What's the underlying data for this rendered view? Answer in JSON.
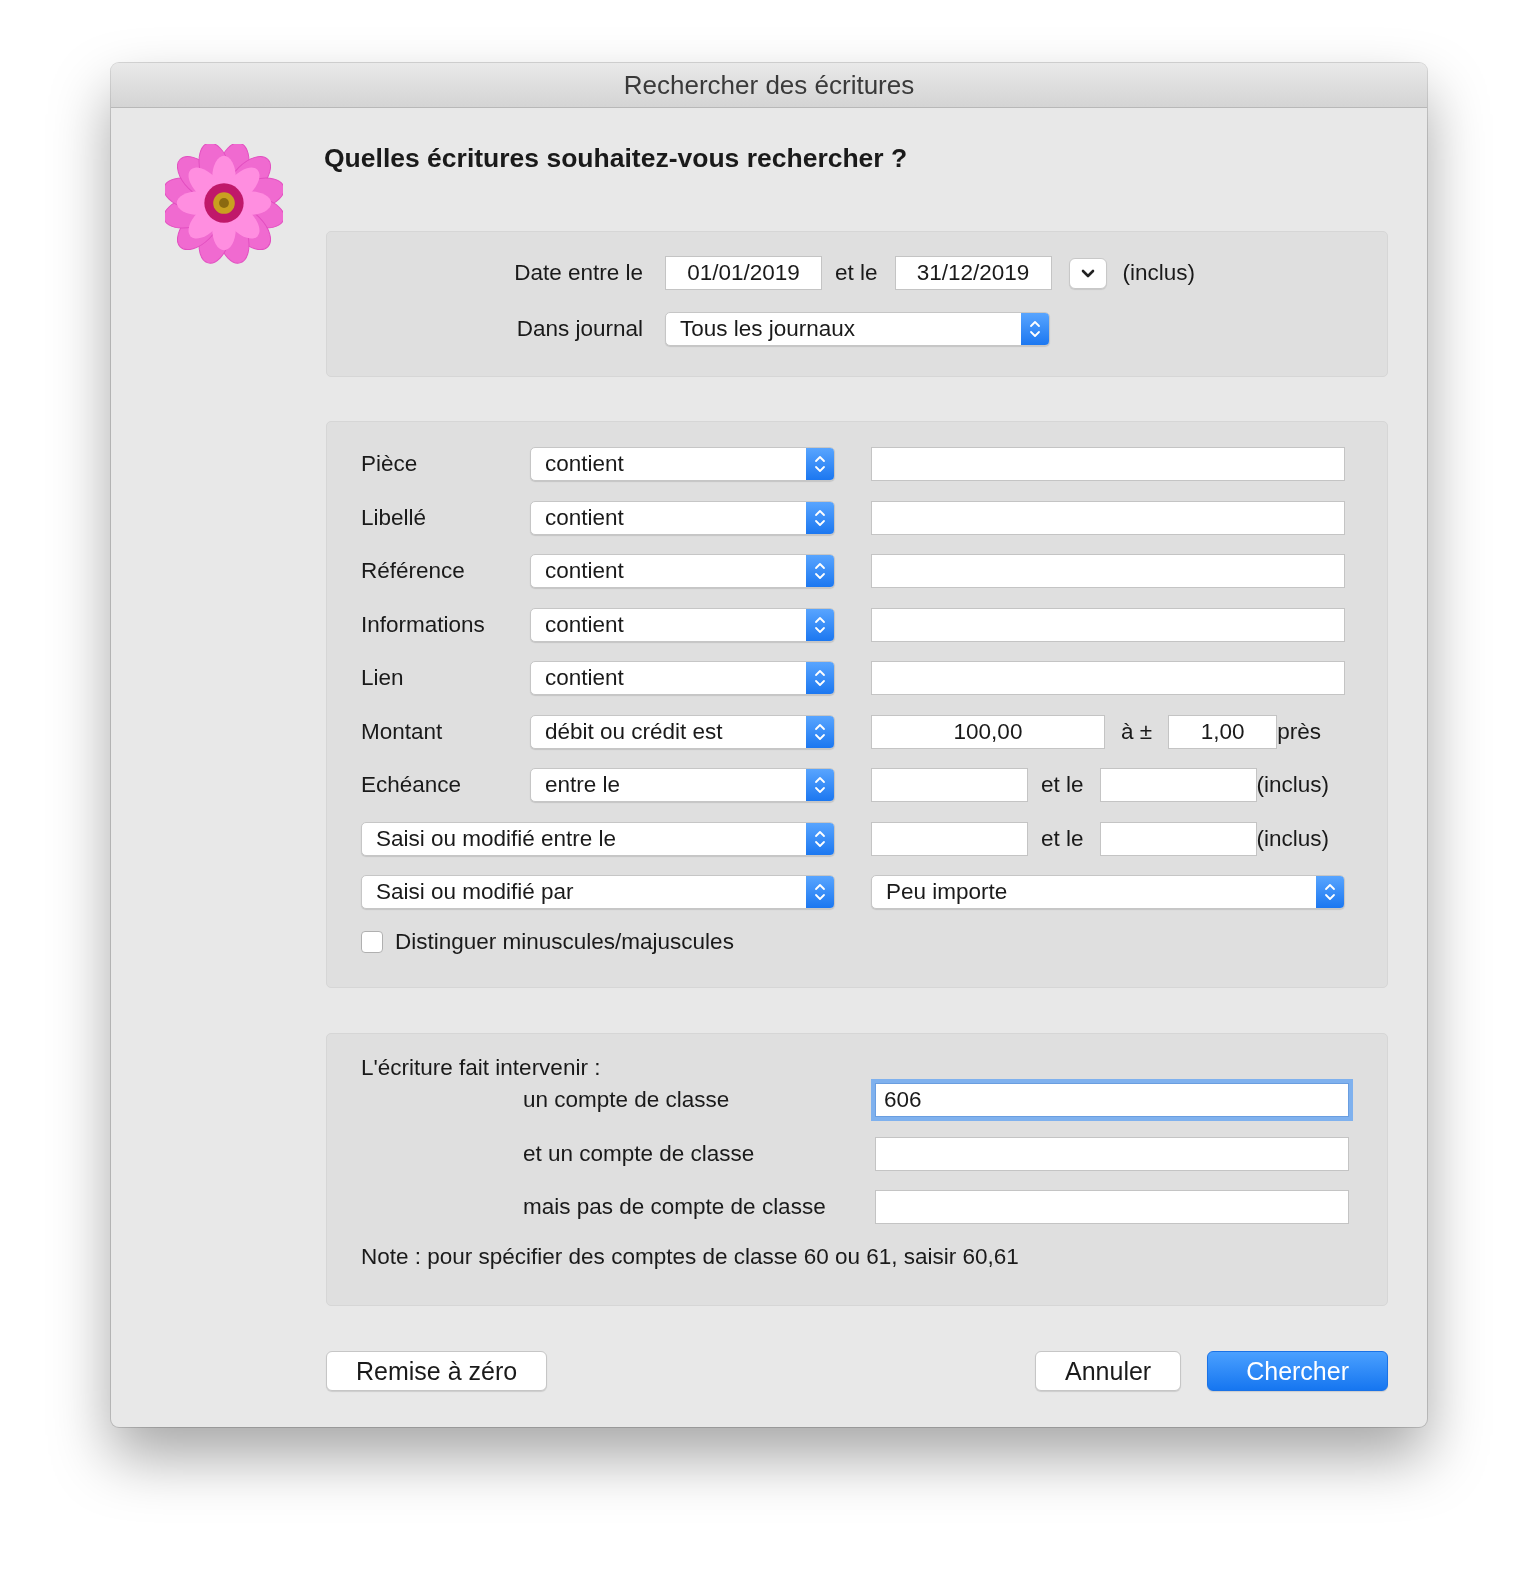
{
  "window": {
    "title": "Rechercher des écritures"
  },
  "heading": "Quelles écritures souhaitez-vous rechercher ?",
  "date_range": {
    "label": "Date entre le",
    "from": "01/01/2019",
    "connector": "et le",
    "to": "31/12/2019",
    "suffix": "(inclus)"
  },
  "journal": {
    "label": "Dans journal",
    "value": "Tous les journaux"
  },
  "criteria": [
    {
      "kind": "text",
      "label": "Pièce",
      "operator": "contient"
    },
    {
      "kind": "text",
      "label": "Libellé",
      "operator": "contient"
    },
    {
      "kind": "text",
      "label": "Référence",
      "operator": "contient"
    },
    {
      "kind": "text",
      "label": "Informations",
      "operator": "contient"
    },
    {
      "kind": "text",
      "label": "Lien",
      "operator": "contient"
    },
    {
      "kind": "amount",
      "label": "Montant",
      "operator": "débit ou crédit est",
      "value": "100,00",
      "tolerance_label": "à ±",
      "tolerance": "1,00",
      "suffix": "près"
    },
    {
      "kind": "range",
      "label": "Echéance",
      "operator": "entre le",
      "connector": "et le",
      "suffix": "(inclus)"
    },
    {
      "kind": "range_select",
      "operator": "Saisi ou modifié entre le",
      "connector": "et le",
      "suffix": "(inclus)"
    },
    {
      "kind": "select_pair",
      "operator": "Saisi ou modifié par",
      "value": "Peu importe"
    }
  ],
  "case_sensitive": {
    "label": "Distinguer minuscules/majuscules",
    "checked": false
  },
  "accounts": {
    "title": "L'écriture fait intervenir :",
    "rows": [
      {
        "label": "un compte de classe",
        "value": "606",
        "focused": true
      },
      {
        "label": "et un compte de classe",
        "focused": false
      },
      {
        "label": "mais pas de compte de classe",
        "focused": false
      }
    ],
    "note": "Note : pour spécifier des comptes de classe 60 ou 61, saisir 60,61"
  },
  "buttons": [
    {
      "label": "Remise à zéro",
      "primary": false
    },
    {
      "label": "Annuler",
      "primary": false
    },
    {
      "label": "Chercher",
      "primary": true
    }
  ]
}
